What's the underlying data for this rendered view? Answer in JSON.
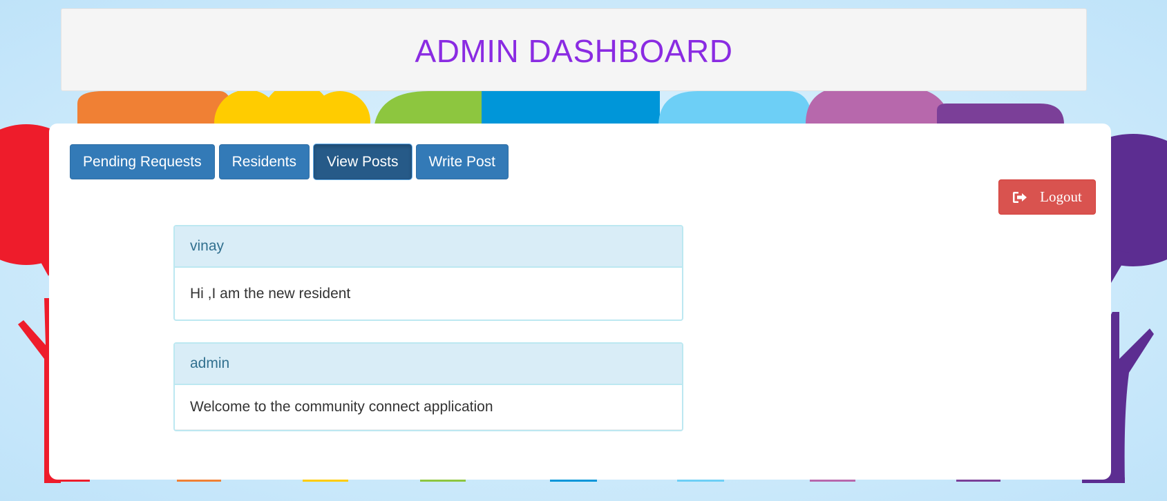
{
  "header": {
    "title": "ADMIN DASHBOARD"
  },
  "nav": {
    "items": [
      {
        "label": "Pending Requests"
      },
      {
        "label": "Residents"
      },
      {
        "label": "View Posts"
      },
      {
        "label": "Write Post"
      }
    ],
    "active": "View Posts"
  },
  "logout": {
    "label": "Logout",
    "icon": "logout-icon"
  },
  "posts": [
    {
      "author": "vinay",
      "content": "Hi ,I am the new resident"
    },
    {
      "author": "admin",
      "content": "Welcome to the community connect application"
    }
  ],
  "colors": {
    "title": "#8a2be2",
    "primary": "#337ab7",
    "primary_active": "#265a88",
    "danger": "#d9534f",
    "panel_heading_bg": "#d9edf7",
    "panel_heading_text": "#31708f",
    "panel_border": "#bce8f1"
  }
}
